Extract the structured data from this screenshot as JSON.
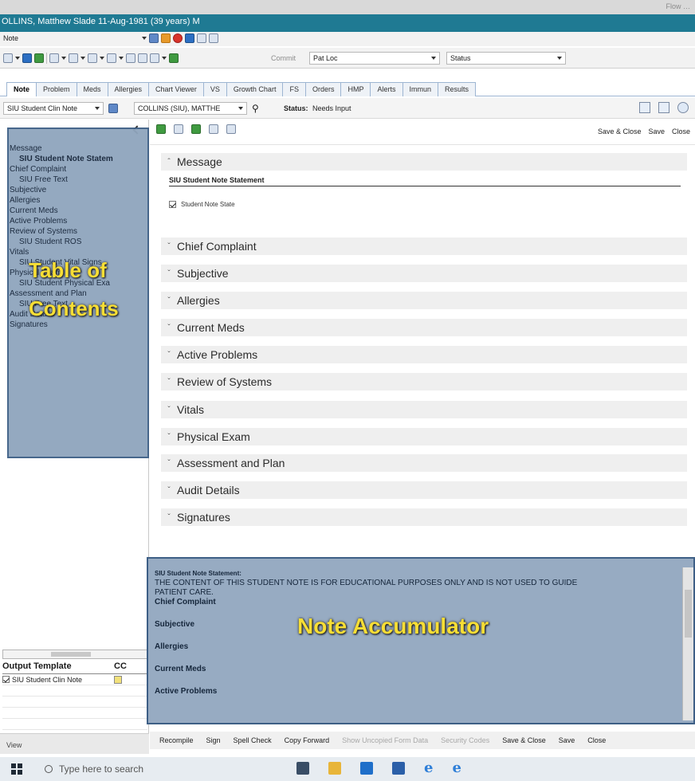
{
  "window": {
    "corner_label": "Flow …",
    "patient_banner": "OLLINS, Matthew Slade  11-Aug-1981  (39 years)  M"
  },
  "toolbar_note": {
    "label": "Note"
  },
  "toolbar_tools": {
    "commit_label": "Commit",
    "patloc_label": "Pat Loc",
    "status_label": "Status"
  },
  "tabs": [
    "Note",
    "Problem",
    "Meds",
    "Allergies",
    "Chart Viewer",
    "VS",
    "Growth Chart",
    "FS",
    "Orders",
    "HMP",
    "Alerts",
    "Immun",
    "Results"
  ],
  "note_header": {
    "note_type": "SIU Student Clin Note",
    "author": "COLLINS (SIU), MATTHE",
    "status_label": "Status:",
    "status_value": "Needs Input"
  },
  "editor_actions": [
    "Save & Close",
    "Save",
    "Close"
  ],
  "toc": {
    "items": [
      {
        "label": "Message",
        "level": 0,
        "selected": true
      },
      {
        "label": "SIU Student Note Statem",
        "level": 1,
        "bold": true
      },
      {
        "label": "Chief Complaint",
        "level": 0
      },
      {
        "label": "SIU Free Text",
        "level": 1
      },
      {
        "label": "Subjective",
        "level": 0
      },
      {
        "label": "Allergies",
        "level": 0
      },
      {
        "label": "Current Meds",
        "level": 0
      },
      {
        "label": "Active Problems",
        "level": 0
      },
      {
        "label": "Review of Systems",
        "level": 0
      },
      {
        "label": "SIU Student ROS",
        "level": 1
      },
      {
        "label": "Vitals",
        "level": 0
      },
      {
        "label": "SIU Student Vital Signs",
        "level": 1
      },
      {
        "label": "Physical Exam",
        "level": 0
      },
      {
        "label": "SIU Student Physical Exa",
        "level": 1
      },
      {
        "label": "Assessment and Plan",
        "level": 0
      },
      {
        "label": "SIU Free Text",
        "level": 1
      },
      {
        "label": "Audit Details",
        "level": 0
      },
      {
        "label": "Signatures",
        "level": 0
      }
    ],
    "caption_line1": "Table of",
    "caption_line2": "Contents"
  },
  "output_table": {
    "col1": "Output Template",
    "col2": "CC",
    "rows": [
      {
        "name": "SIU Student Clin Note",
        "checked": true
      }
    ]
  },
  "left_footer": "View",
  "sections": {
    "message": {
      "label": "Message",
      "statement": "SIU Student Note Statement",
      "option": "Student Note State"
    },
    "chief_complaint": "Chief Complaint",
    "subjective": "Subjective",
    "allergies": "Allergies",
    "current_meds": "Current Meds",
    "active_problems": "Active Problems",
    "review_of_systems": "Review of Systems",
    "vitals": "Vitals",
    "physical_exam": "Physical Exam",
    "assessment_plan": "Assessment and Plan",
    "audit_details": "Audit Details",
    "signatures": "Signatures"
  },
  "accumulator": {
    "statement_heading": "SIU Student Note Statement:",
    "statement_text_1": "THE CONTENT OF THIS STUDENT NOTE IS FOR EDUCATIONAL PURPOSES ONLY AND IS NOT USED TO GUIDE",
    "statement_text_2": "PATIENT CARE.",
    "headings": [
      "Chief Complaint",
      "Subjective",
      "Allergies",
      "Current Meds",
      "Active Problems"
    ],
    "caption": "Note Accumulator"
  },
  "bottom_actions": {
    "recompile": "Recompile",
    "sign": "Sign",
    "spell_check": "Spell Check",
    "copy_forward": "Copy Forward",
    "show_uncopied": "Show Uncopied Form Data",
    "security_codes": "Security Codes",
    "save_close": "Save & Close",
    "save": "Save",
    "close": "Close"
  },
  "taskbar": {
    "search_placeholder": "Type here to search"
  },
  "colors": {
    "banner": "#1f7a93",
    "overlay": "#8fa5bd",
    "overlay_border": "#3e5f86",
    "caption": "#f7de35"
  }
}
